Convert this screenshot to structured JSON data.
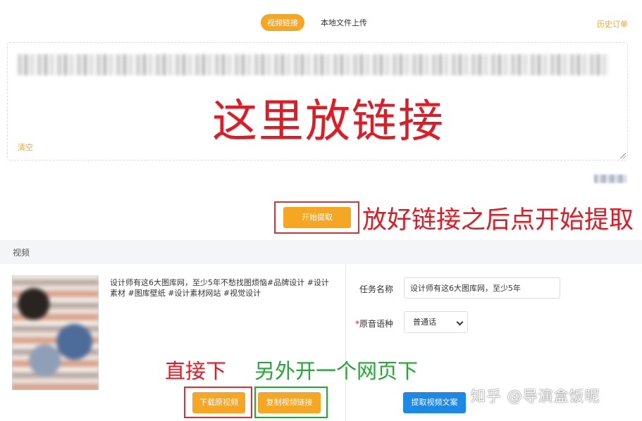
{
  "tabs": {
    "video_link": "视频链接",
    "local_upload": "本地文件上传"
  },
  "history_link": "历史订单",
  "link_area": {
    "annotation": "这里放链接",
    "clear_label": "清空"
  },
  "start": {
    "button_label": "开始提取",
    "annotation": "放好链接之后点开始提取"
  },
  "section": {
    "title": "视频"
  },
  "video": {
    "description": "设计师有这6大图库网，至少5年不愁找图烦恼#品牌设计 #设计素材 #图库壁纸 #设计素材网站 #视觉设计"
  },
  "annotations": {
    "direct_download": "直接下",
    "open_new_page": "另外开一个网页下"
  },
  "buttons": {
    "download_original": "下载原视频",
    "copy_link": "复制视频链接",
    "extract_text": "提取视频文案"
  },
  "form": {
    "task_name_label": "任务名称",
    "task_name_value": "设计师有这6大图库网，至少5年",
    "language_required_mark": "*",
    "language_label": "原音语种",
    "language_value": "普通话"
  },
  "watermark": "知乎 @导演盒饭呢",
  "colors": {
    "accent_orange": "#f5a623",
    "primary_blue": "#1e88e5",
    "annotation_red": "#e01b24",
    "annotation_green": "#23a836"
  }
}
